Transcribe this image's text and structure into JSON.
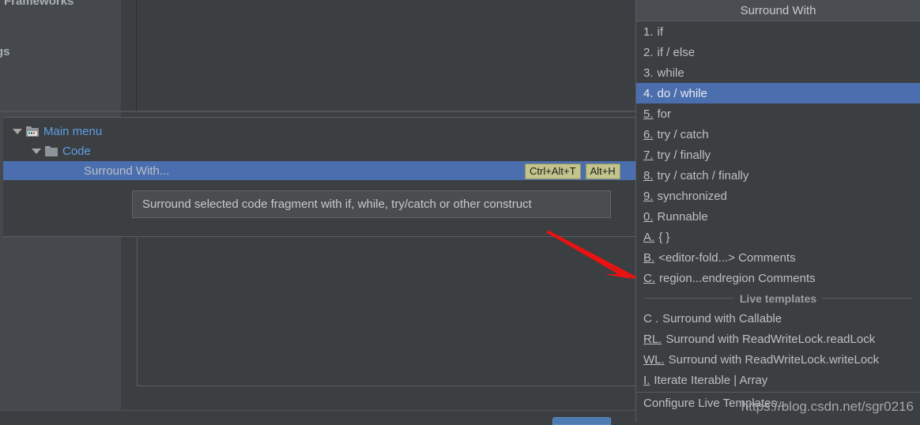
{
  "background": {
    "left_panel": {
      "label_top": "Frameworks",
      "label_bottom": "gs"
    },
    "tree": {
      "rows": [
        {
          "label": "Main menu",
          "icon": "menu-folder-icon",
          "expanded": true
        },
        {
          "label": "Code",
          "icon": "folder-icon",
          "expanded": true
        },
        {
          "label": "Surround With...",
          "icon": "none",
          "selected": true
        }
      ],
      "shortcuts": [
        "Ctrl+Alt+T",
        "Alt+H"
      ]
    },
    "tooltip": {
      "text": "Surround selected code fragment with if, while, try/catch or other construct"
    },
    "ok_button_label": ""
  },
  "popup": {
    "title": "Surround With",
    "items": [
      {
        "mnemonic": "1.",
        "underline": false,
        "label": "if",
        "selected": false
      },
      {
        "mnemonic": "2.",
        "underline": false,
        "label": "if / else",
        "selected": false
      },
      {
        "mnemonic": "3.",
        "underline": false,
        "label": "while",
        "selected": false
      },
      {
        "mnemonic": "4.",
        "underline": false,
        "label": "do / while",
        "selected": true
      },
      {
        "mnemonic": "5.",
        "underline": true,
        "label": "for",
        "selected": false
      },
      {
        "mnemonic": "6.",
        "underline": true,
        "label": "try / catch",
        "selected": false
      },
      {
        "mnemonic": "7.",
        "underline": true,
        "label": "try / finally",
        "selected": false
      },
      {
        "mnemonic": "8.",
        "underline": true,
        "label": "try / catch / finally",
        "selected": false
      },
      {
        "mnemonic": "9.",
        "underline": true,
        "label": "synchronized",
        "selected": false
      },
      {
        "mnemonic": "0.",
        "underline": true,
        "label": "Runnable",
        "selected": false
      },
      {
        "mnemonic": "A.",
        "underline": true,
        "label": "{ }",
        "selected": false
      },
      {
        "mnemonic": "B.",
        "underline": true,
        "label": "<editor-fold...> Comments",
        "selected": false
      },
      {
        "mnemonic": "C.",
        "underline": true,
        "label": "region...endregion Comments",
        "selected": false
      }
    ],
    "group_separator": "Live templates",
    "template_items": [
      {
        "mnemonic": "C .",
        "underline": false,
        "label": "Surround with Callable"
      },
      {
        "mnemonic": "RL.",
        "underline": true,
        "label": "Surround with ReadWriteLock.readLock"
      },
      {
        "mnemonic": "WL.",
        "underline": true,
        "label": "Surround with ReadWriteLock.writeLock"
      },
      {
        "mnemonic": "I.",
        "underline": true,
        "label": "Iterate Iterable | Array"
      }
    ],
    "footer_item": {
      "mnemonic": "",
      "underline": false,
      "label": "Configure Live Templates..."
    }
  },
  "watermark": "https://blog.csdn.net/sgr0216",
  "colors": {
    "selection_blue": "#4b6eaf",
    "popup_bg": "#3c3f41",
    "popup_header_bg": "#4a4d51",
    "panel_bg": "#45494d",
    "link_blue": "#5c9ee6",
    "shortcut_badge": "#c3c48c",
    "annotation_red": "#ee1111"
  }
}
